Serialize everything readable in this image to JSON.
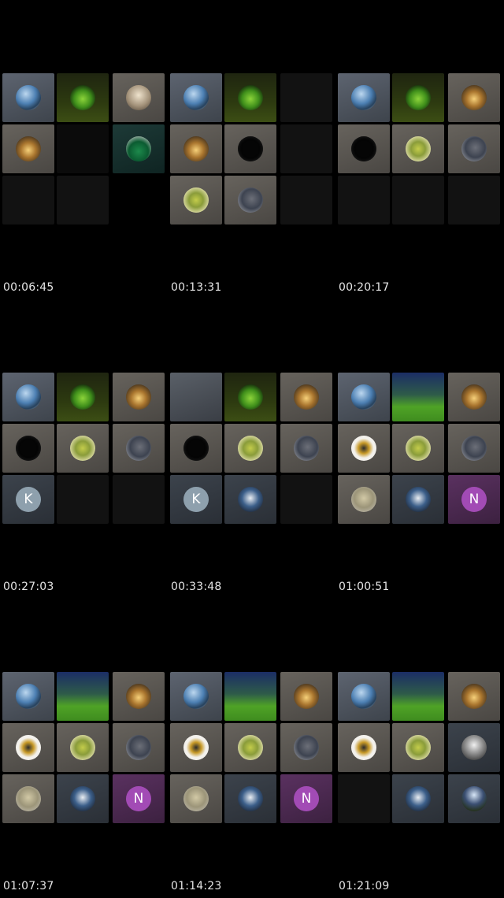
{
  "panels": [
    {
      "timestamp": "00:06:45",
      "tiles": [
        {
          "bg": "gray",
          "avatar": "mountain"
        },
        {
          "bg": "olive",
          "avatar": "pitch"
        },
        {
          "bg": "tan",
          "avatar": "building"
        },
        {
          "bg": "tan",
          "avatar": "sunset"
        },
        {
          "bg": "verydark",
          "avatar": ""
        },
        {
          "bg": "teal",
          "avatar": "jersey"
        },
        {
          "bg": "dark",
          "avatar": ""
        },
        {
          "bg": "dark",
          "avatar": ""
        },
        {
          "bg": "none",
          "avatar": ""
        }
      ]
    },
    {
      "timestamp": "00:13:31",
      "tiles": [
        {
          "bg": "gray",
          "avatar": "mountain"
        },
        {
          "bg": "olive",
          "avatar": "pitch"
        },
        {
          "bg": "dark",
          "avatar": ""
        },
        {
          "bg": "tan",
          "avatar": "sunset"
        },
        {
          "bg": "tan",
          "avatar": "black"
        },
        {
          "bg": "dark",
          "avatar": ""
        },
        {
          "bg": "tan",
          "avatar": "crowd"
        },
        {
          "bg": "tan",
          "avatar": "selfie"
        },
        {
          "bg": "dark",
          "avatar": ""
        }
      ]
    },
    {
      "timestamp": "00:20:17",
      "tiles": [
        {
          "bg": "gray",
          "avatar": "mountain"
        },
        {
          "bg": "olive",
          "avatar": "pitch"
        },
        {
          "bg": "tan",
          "avatar": "sunset"
        },
        {
          "bg": "tan",
          "avatar": "black"
        },
        {
          "bg": "tan",
          "avatar": "crowd"
        },
        {
          "bg": "tan",
          "avatar": "selfie"
        },
        {
          "bg": "dark",
          "avatar": ""
        },
        {
          "bg": "dark",
          "avatar": ""
        },
        {
          "bg": "dark",
          "avatar": ""
        }
      ]
    },
    {
      "timestamp": "00:27:03",
      "tiles": [
        {
          "bg": "gray",
          "avatar": "mountain"
        },
        {
          "bg": "olive",
          "avatar": "pitch"
        },
        {
          "bg": "tan",
          "avatar": "sunset"
        },
        {
          "bg": "tan",
          "avatar": "black"
        },
        {
          "bg": "tan",
          "avatar": "crowd"
        },
        {
          "bg": "tan",
          "avatar": "selfie"
        },
        {
          "bg": "slate",
          "avatar": "letterK",
          "letter": "K"
        },
        {
          "bg": "dark",
          "avatar": ""
        },
        {
          "bg": "dark",
          "avatar": ""
        }
      ]
    },
    {
      "timestamp": "00:33:48",
      "tiles": [
        {
          "bg": "plain",
          "avatar": ""
        },
        {
          "bg": "olive",
          "avatar": "pitch"
        },
        {
          "bg": "tan",
          "avatar": "sunset"
        },
        {
          "bg": "tan",
          "avatar": "black"
        },
        {
          "bg": "tan",
          "avatar": "crowd"
        },
        {
          "bg": "tan",
          "avatar": "selfie"
        },
        {
          "bg": "slate",
          "avatar": "letterK",
          "letter": "K"
        },
        {
          "bg": "slate",
          "avatar": "boat"
        },
        {
          "bg": "dark",
          "avatar": ""
        }
      ]
    },
    {
      "timestamp": "01:00:51",
      "tiles": [
        {
          "bg": "gray",
          "avatar": "mountain"
        },
        {
          "bg": "field",
          "avatar": ""
        },
        {
          "bg": "tan",
          "avatar": "sunset"
        },
        {
          "bg": "tan",
          "avatar": "skate"
        },
        {
          "bg": "tan",
          "avatar": "crowd"
        },
        {
          "bg": "tan",
          "avatar": "selfie"
        },
        {
          "bg": "tan",
          "avatar": "street"
        },
        {
          "bg": "slate",
          "avatar": "boat"
        },
        {
          "bg": "plum",
          "avatar": "letterN",
          "letter": "N"
        }
      ]
    },
    {
      "timestamp": "01:07:37",
      "tiles": [
        {
          "bg": "gray",
          "avatar": "mountain"
        },
        {
          "bg": "field",
          "avatar": ""
        },
        {
          "bg": "tan",
          "avatar": "sunset"
        },
        {
          "bg": "tan",
          "avatar": "skate"
        },
        {
          "bg": "tan",
          "avatar": "crowd"
        },
        {
          "bg": "tan",
          "avatar": "selfie"
        },
        {
          "bg": "tan",
          "avatar": "street"
        },
        {
          "bg": "slate",
          "avatar": "boat"
        },
        {
          "bg": "plum",
          "avatar": "letterN",
          "letter": "N"
        }
      ]
    },
    {
      "timestamp": "01:14:23",
      "tiles": [
        {
          "bg": "gray",
          "avatar": "mountain"
        },
        {
          "bg": "field",
          "avatar": ""
        },
        {
          "bg": "tan",
          "avatar": "sunset"
        },
        {
          "bg": "tan",
          "avatar": "skate"
        },
        {
          "bg": "tan",
          "avatar": "crowd"
        },
        {
          "bg": "tan",
          "avatar": "selfie"
        },
        {
          "bg": "tan",
          "avatar": "street"
        },
        {
          "bg": "slate",
          "avatar": "boat"
        },
        {
          "bg": "plum",
          "avatar": "letterN",
          "letter": "N"
        }
      ]
    },
    {
      "timestamp": "01:21:09",
      "tiles": [
        {
          "bg": "gray",
          "avatar": "mountain"
        },
        {
          "bg": "field",
          "avatar": ""
        },
        {
          "bg": "tan",
          "avatar": "sunset"
        },
        {
          "bg": "tan",
          "avatar": "skate"
        },
        {
          "bg": "tan",
          "avatar": "crowd"
        },
        {
          "bg": "slate",
          "avatar": "city"
        },
        {
          "bg": "dark",
          "avatar": ""
        },
        {
          "bg": "slate",
          "avatar": "boat"
        },
        {
          "bg": "slate",
          "avatar": "plaza"
        }
      ]
    }
  ]
}
